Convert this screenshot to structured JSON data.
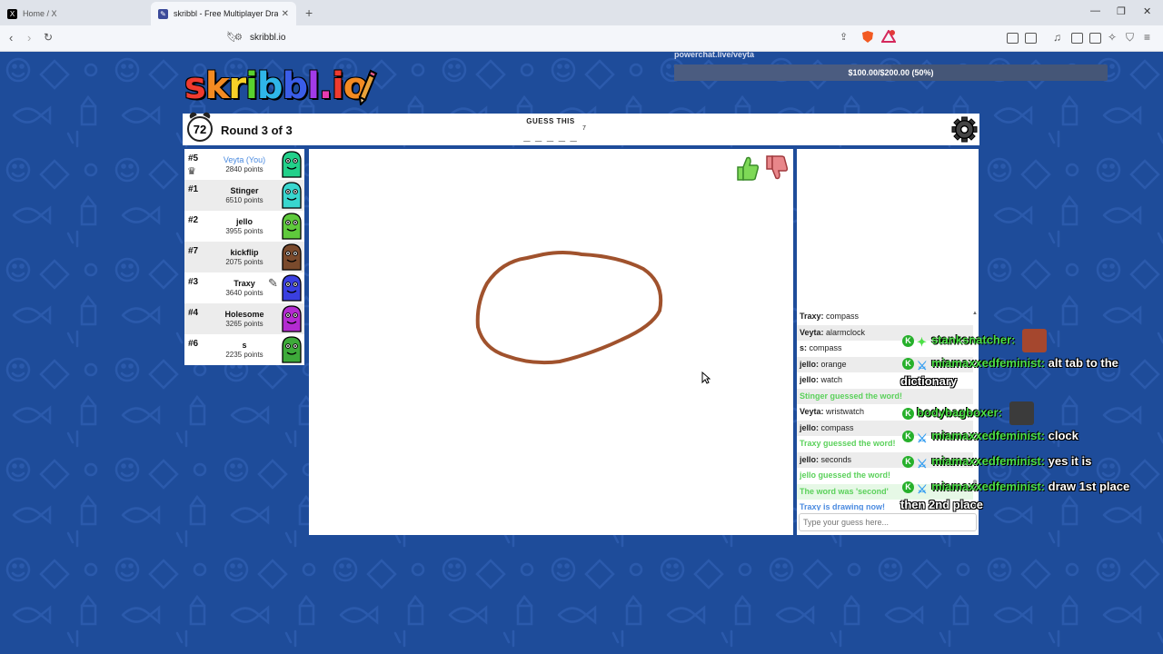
{
  "browser": {
    "tabs": [
      {
        "title": "Home / X",
        "favicon": "x-logo-icon"
      },
      {
        "title": "skribbl - Free Multiplayer Drawi",
        "favicon": "skribbl-icon"
      }
    ],
    "new_tab": "+",
    "url": "skribbl.io",
    "window_controls": {
      "minimize": "—",
      "maximize": "❐",
      "close": "✕"
    }
  },
  "stream": {
    "channel": "powerchat.live/veyta",
    "goal_text": "$100.00/$200.00 (50%)",
    "goal_fraction": 0.5
  },
  "game": {
    "logo": "skribbl.io",
    "timer": "72",
    "round": "Round 3 of 3",
    "guess_label": "GUESS THIS",
    "hint": "_ _ _ _ _ _ _",
    "hint_count": "7"
  },
  "players": [
    {
      "rank": "#5",
      "name": "Veyta (You)",
      "points": "2840 points",
      "you": true,
      "color": "#22d08a"
    },
    {
      "rank": "#1",
      "name": "Stinger",
      "points": "6510 points",
      "color": "#39d6cf"
    },
    {
      "rank": "#2",
      "name": "jello",
      "points": "3955 points",
      "color": "#5fc93c"
    },
    {
      "rank": "#7",
      "name": "kickflip",
      "points": "2075 points",
      "color": "#7a4a2c"
    },
    {
      "rank": "#3",
      "name": "Traxy",
      "points": "3640 points",
      "drawing": true,
      "color": "#3a3fe0"
    },
    {
      "rank": "#4",
      "name": "Holesome",
      "points": "3265 points",
      "color": "#b42bd1"
    },
    {
      "rank": "#6",
      "name": "s",
      "points": "2235 points",
      "color": "#3eaa3a"
    }
  ],
  "chat": [
    {
      "user": "Traxy",
      "text": "compass"
    },
    {
      "user": "Veyta",
      "text": "alarmclock"
    },
    {
      "user": "s",
      "text": "compass"
    },
    {
      "user": "jello",
      "text": "orange"
    },
    {
      "user": "jello",
      "text": "watch"
    },
    {
      "system": "Stinger guessed the word!",
      "kind": "green"
    },
    {
      "user": "Veyta",
      "text": "wristwatch"
    },
    {
      "user": "jello",
      "text": "compass"
    },
    {
      "system": "Traxy guessed the word!",
      "kind": "green"
    },
    {
      "user": "jello",
      "text": "seconds"
    },
    {
      "system": "jello guessed the word!",
      "kind": "green"
    },
    {
      "system": "The word was 'second'",
      "kind": "green2"
    },
    {
      "system": "Traxy is drawing now!",
      "kind": "blue"
    }
  ],
  "chat_input": {
    "placeholder": "Type your guess here..."
  },
  "overlay_chat": [
    {
      "user": "stanksnatcher:",
      "text": "",
      "avatar": true
    },
    {
      "user": "miamaxxedfeminist:",
      "text": "alt tab to the",
      "cont": "dictionary"
    },
    {
      "user": "bodybagboxer:",
      "text": "",
      "avatar": true
    },
    {
      "user": "miamaxxedfeminist:",
      "text": "clock"
    },
    {
      "user": "miamaxxedfeminist:",
      "text": "yes it is"
    },
    {
      "user": "miamaxxedfeminist:",
      "text": "draw 1st place",
      "cont": "then 2nd place"
    }
  ],
  "colors": {
    "background": "#1e4c9a",
    "guess_green": "#5bd15b",
    "drawing_blue": "#4b8be0",
    "stroke_brown": "#a0522d"
  }
}
